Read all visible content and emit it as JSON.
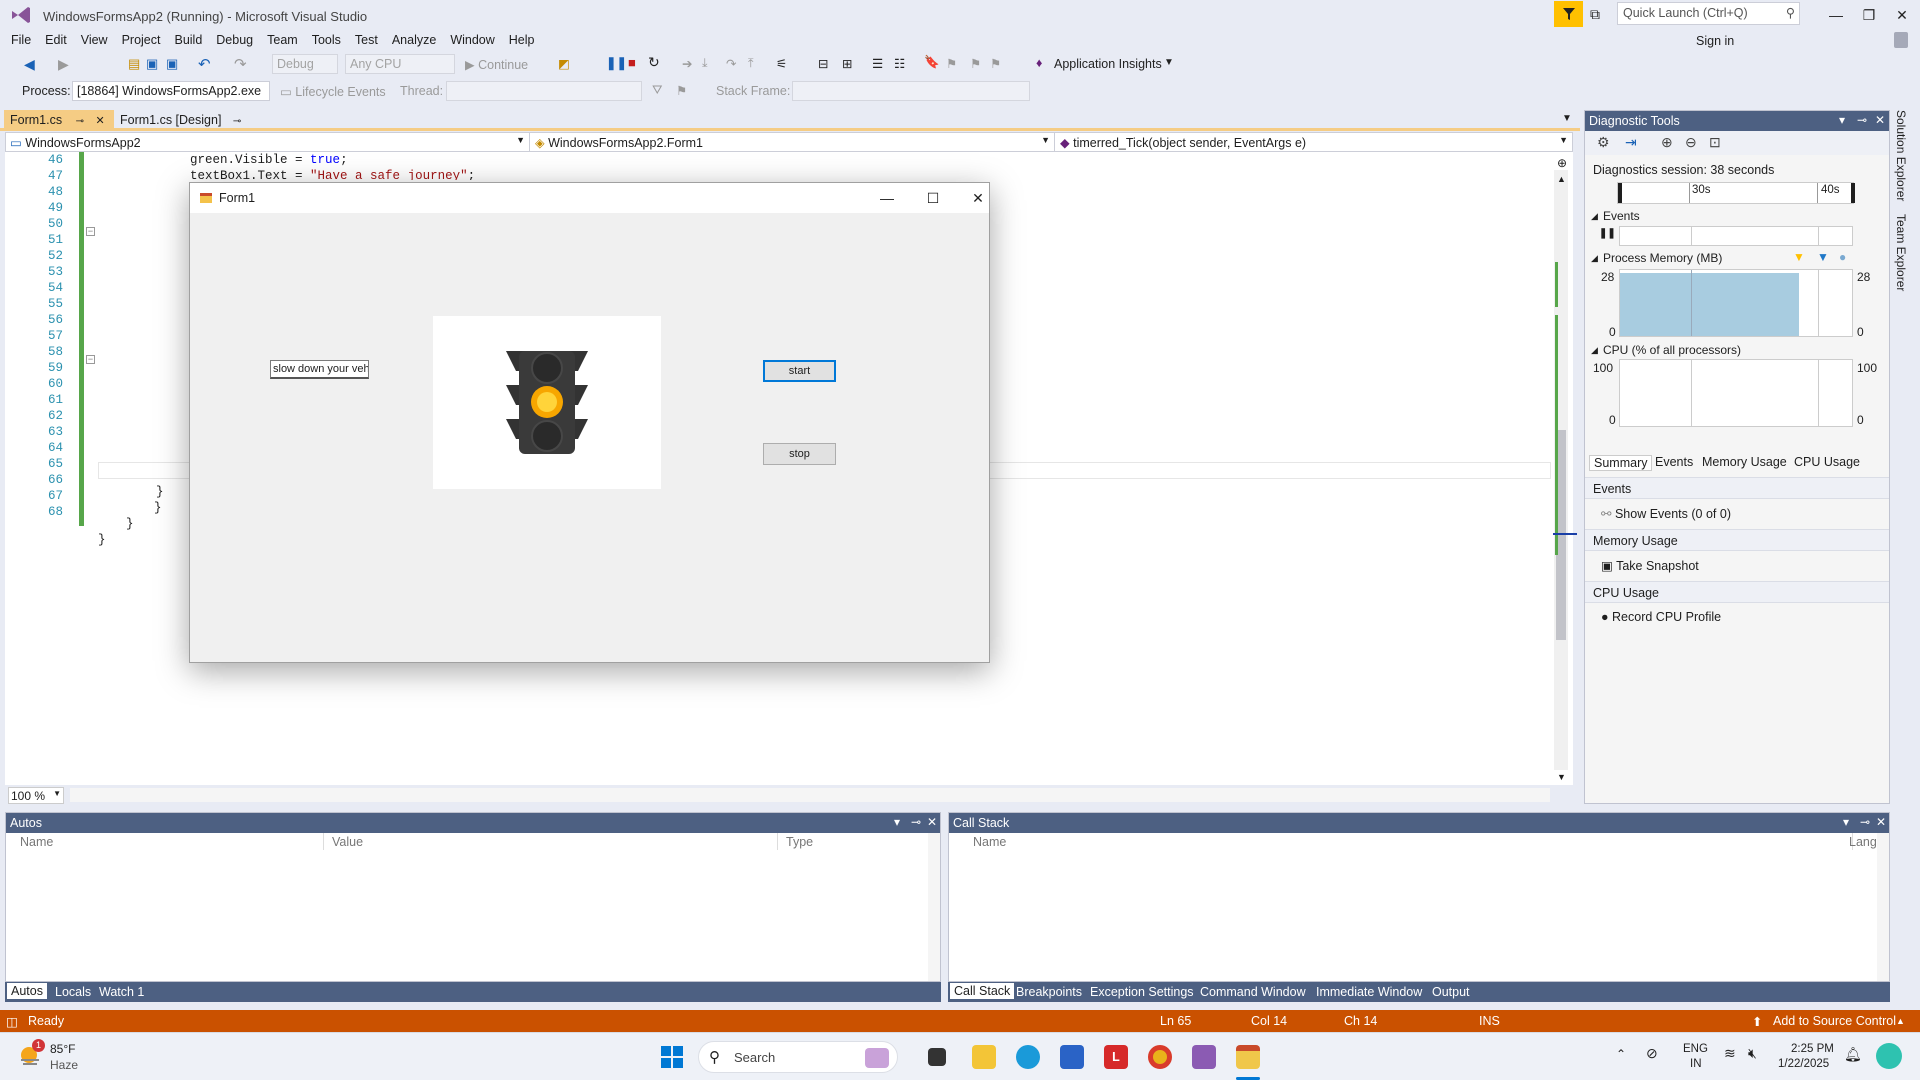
{
  "window": {
    "title": "WindowsFormsApp2 (Running) - Microsoft Visual Studio"
  },
  "quick_launch": {
    "placeholder": "Quick Launch (Ctrl+Q)"
  },
  "menu": [
    "File",
    "Edit",
    "View",
    "Project",
    "Build",
    "Debug",
    "Team",
    "Tools",
    "Test",
    "Analyze",
    "Window",
    "Help"
  ],
  "signin": "Sign in",
  "toolbar": {
    "config": "Debug",
    "platform": "Any CPU",
    "continue": "Continue",
    "app_insights": "Application Insights"
  },
  "processbar": {
    "process_label": "Process:",
    "process_value": "[18864] WindowsFormsApp2.exe",
    "lifecycle": "Lifecycle Events",
    "thread_label": "Thread:",
    "stack_frame_label": "Stack Frame:"
  },
  "doc_tabs": [
    {
      "label": "Form1.cs",
      "active": true
    },
    {
      "label": "Form1.cs [Design]",
      "active": false
    }
  ],
  "nav": {
    "project": "WindowsFormsApp2",
    "class": "WindowsFormsApp2.Form1",
    "member": "timerred_Tick(object sender, EventArgs e)"
  },
  "editor": {
    "lines": [
      "46",
      "47",
      "48",
      "49",
      "50",
      "51",
      "52",
      "53",
      "54",
      "55",
      "56",
      "57",
      "58",
      "59",
      "60",
      "61",
      "62",
      "63",
      "64",
      "65",
      "66",
      "67",
      "68"
    ],
    "code_46_a": "            green.Visible = ",
    "code_46_kw": "true",
    "code_46_b": ";",
    "code_47_a": "            textBox1.Text = ",
    "code_47_str": "\"Have a safe journey\"",
    "code_47_b": ";",
    "zoom": "100 %"
  },
  "form1": {
    "title": "Form1",
    "textbox_value": "slow down your veh",
    "start_button": "start",
    "stop_button": "stop",
    "active_light": "yellow"
  },
  "diagnostics": {
    "title": "Diagnostic Tools",
    "session": "Diagnostics session: 38 seconds",
    "tick_30": "30s",
    "tick_40": "40s",
    "events_label": "Events",
    "memory_label": "Process Memory (MB)",
    "memory_max": "28",
    "memory_min": "0",
    "cpu_label": "CPU (% of all processors)",
    "cpu_max": "100",
    "cpu_min": "0",
    "tabs": [
      "Summary",
      "Events",
      "Memory Usage",
      "CPU Usage"
    ],
    "sect_events": "Events",
    "show_events": "Show Events (0 of 0)",
    "sect_memory": "Memory Usage",
    "take_snapshot": "Take Snapshot",
    "sect_cpu": "CPU Usage",
    "record_cpu": "Record CPU Profile",
    "colors": {
      "memory_fill": "#a8cce0",
      "marker_yellow": "#ffc000",
      "marker_blue": "#1f78c8"
    }
  },
  "side_tabs": [
    "Solution Explorer",
    "Team Explorer"
  ],
  "autos": {
    "title": "Autos",
    "columns": [
      "Name",
      "Value",
      "Type"
    ],
    "tabs": [
      "Autos",
      "Locals",
      "Watch 1"
    ]
  },
  "callstack": {
    "title": "Call Stack",
    "columns": [
      "Name",
      "Lang"
    ],
    "tabs": [
      "Call Stack",
      "Breakpoints",
      "Exception Settings",
      "Command Window",
      "Immediate Window",
      "Output"
    ]
  },
  "status": {
    "ready": "Ready",
    "ln": "Ln 65",
    "col": "Col 14",
    "ch": "Ch 14",
    "ins": "INS",
    "source_control": "Add to Source Control",
    "color": "#ca5100"
  },
  "taskbar": {
    "weather_temp": "85°F",
    "weather_desc": "Haze",
    "weather_badge": "1",
    "search": "Search",
    "lang_1": "ENG",
    "lang_2": "IN",
    "time": "2:25 PM",
    "date": "1/22/2025"
  }
}
